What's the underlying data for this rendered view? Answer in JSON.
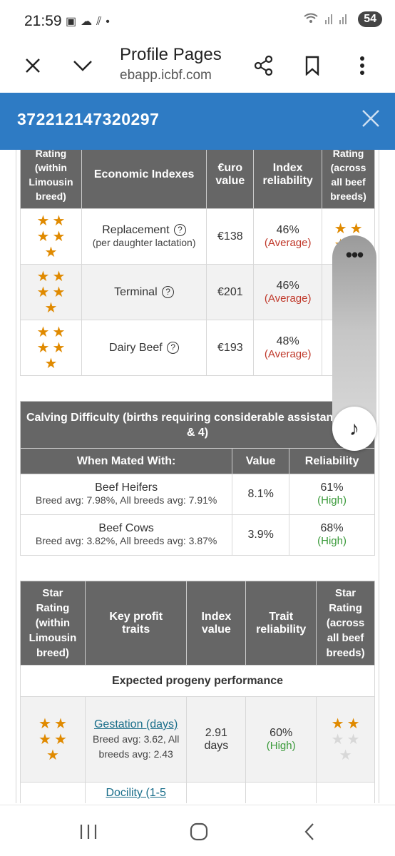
{
  "status": {
    "time": "21:59",
    "battery": "54"
  },
  "browser": {
    "title": "Profile Pages",
    "url": "ebapp.icbf.com"
  },
  "header": {
    "animal_id": "372212147320297"
  },
  "econ_table": {
    "headers": {
      "star_left": "Rating\n(within\nLimousin\nbreed)",
      "index": "Economic Indexes",
      "euro": "€uro\nvalue",
      "reliability": "Index\nreliability",
      "star_right": "Rating\n(across\nall beef\nbreeds)"
    },
    "rows": [
      {
        "name": "Replacement",
        "sub": "(per daughter lactation)",
        "value": "€138",
        "rel": "46%",
        "rel_label": "(Average)"
      },
      {
        "name": "Terminal",
        "sub": "",
        "value": "€201",
        "rel": "46%",
        "rel_label": "(Average)"
      },
      {
        "name": "Dairy Beef",
        "sub": "",
        "value": "€193",
        "rel": "48%",
        "rel_label": "(Average)"
      }
    ]
  },
  "calving": {
    "title": "Calving Difficulty (births requiring considerable assistance % 3 & 4)",
    "cols": {
      "mated": "When Mated With:",
      "value": "Value",
      "rel": "Reliability"
    },
    "rows": [
      {
        "name": "Beef Heifers",
        "avg": "Breed avg: 7.98%, All breeds avg: 7.91%",
        "value": "8.1%",
        "rel": "61%",
        "rel_label": "(High)"
      },
      {
        "name": "Beef Cows",
        "avg": "Breed avg: 3.82%, All breeds avg: 3.87%",
        "value": "3.9%",
        "rel": "68%",
        "rel_label": "(High)"
      }
    ]
  },
  "traits": {
    "headers": {
      "star_left": "Star\nRating\n(within\nLimousin\nbreed)",
      "trait": "Key profit\ntraits",
      "index": "Index\nvalue",
      "rel": "Trait\nreliability",
      "star_right": "Star\nRating\n(across\nall beef\nbreeds)"
    },
    "section": "Expected progeny performance",
    "rows": [
      {
        "name": "Gestation (days)",
        "avg": "Breed avg: 3.62, All breeds avg: 2.43",
        "value": "2.91\ndays",
        "rel": "60%",
        "rel_label": "(High)"
      },
      {
        "name": "Docility (1-5",
        "avg": "",
        "value": "",
        "rel": "",
        "rel_label": ""
      }
    ]
  },
  "colors": {
    "header_blue": "#2e7bc4",
    "table_head": "#666666",
    "star": "#e08a00",
    "average": "#c0392b",
    "high": "#3a9a3a"
  }
}
